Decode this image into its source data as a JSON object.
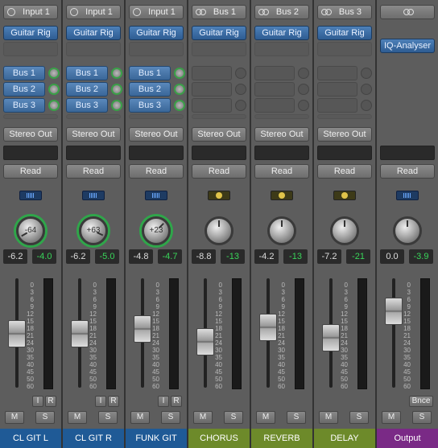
{
  "strips": [
    {
      "input": "Input 1",
      "input_icon": "mono-circle-icon",
      "plugin": "Guitar Rig",
      "sends": [
        "Bus 1",
        "Bus 2",
        "Bus 3"
      ],
      "output": "Stereo Out",
      "automation": "Read",
      "pan": "-64",
      "volume": "-6.2",
      "peak": "-4.0",
      "name": "CL GIT L",
      "name_color": "#1f5a96"
    },
    {
      "input": "Input 1",
      "input_icon": "mono-circle-icon",
      "plugin": "Guitar Rig",
      "sends": [
        "Bus 1",
        "Bus 2",
        "Bus 3"
      ],
      "output": "Stereo Out",
      "automation": "Read",
      "pan": "+63",
      "volume": "-6.2",
      "peak": "-5.0",
      "name": "CL GIT R",
      "name_color": "#1f5a96"
    },
    {
      "input": "Input 1",
      "input_icon": "mono-circle-icon",
      "plugin": "Guitar Rig",
      "sends": [
        "Bus 1",
        "Bus 2",
        "Bus 3"
      ],
      "output": "Stereo Out",
      "automation": "Read",
      "pan": "+23",
      "volume": "-4.8",
      "peak": "-4.7",
      "name": "FUNK GIT",
      "name_color": "#1f5a96"
    },
    {
      "input": "Bus 1",
      "input_icon": "stereo-circles-icon",
      "plugin": "Guitar Rig",
      "sends": [],
      "output": "Stereo Out",
      "automation": "Read",
      "pan": "",
      "volume": "-8.8",
      "peak": "-13",
      "name": "CHORUS",
      "name_color": "#6d8a2a"
    },
    {
      "input": "Bus 2",
      "input_icon": "stereo-circles-icon",
      "plugin": "Guitar Rig",
      "sends": [],
      "output": "Stereo Out",
      "automation": "Read",
      "pan": "",
      "volume": "-4.2",
      "peak": "-13",
      "name": "REVERB",
      "name_color": "#6d8a2a"
    },
    {
      "input": "Bus 3",
      "input_icon": "stereo-circles-icon",
      "plugin": "Guitar Rig",
      "sends": [],
      "output": "Stereo Out",
      "automation": "Read",
      "pan": "",
      "volume": "-7.2",
      "peak": "-21",
      "name": "DELAY",
      "name_color": "#6d8a2a"
    },
    {
      "input": "",
      "input_icon": "stereo-circles-icon",
      "plugin": "IQ-Analyser",
      "sends": [],
      "output": "",
      "automation": "Read",
      "pan": "",
      "volume": "0.0",
      "peak": "-3.9",
      "name": "Output",
      "name_color": "#7a2a86"
    }
  ],
  "labels": {
    "mute": "M",
    "solo": "S",
    "input_monitor": "I",
    "record": "R",
    "bounce": "Bnce"
  },
  "scale": [
    "0",
    "3",
    "6",
    "9",
    "12",
    "15",
    "18",
    "21",
    "24",
    "30",
    "35",
    "40",
    "45",
    "50",
    "60"
  ]
}
